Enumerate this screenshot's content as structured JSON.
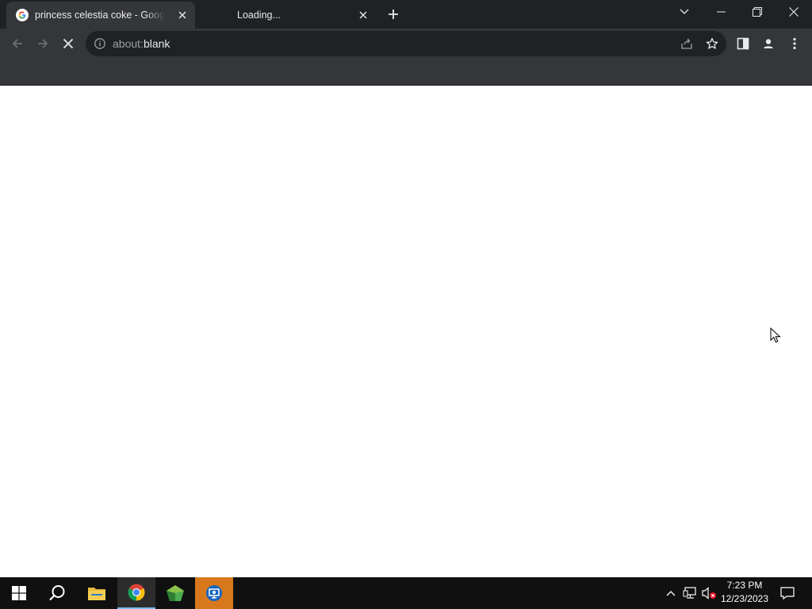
{
  "browser": {
    "tabs": [
      {
        "title": "princess celestia coke - Google S",
        "active": true,
        "favicon": "google-g-icon"
      },
      {
        "title": "Loading...",
        "active": false,
        "favicon": "loading-spinner-icon"
      }
    ],
    "omnibox": {
      "scheme": "about:",
      "host": "blank"
    },
    "colors": {
      "tabstrip": "#202124",
      "toolbar": "#35363a",
      "omnibox": "#202124"
    }
  },
  "taskbar": {
    "apps": [
      {
        "name": "start-icon"
      },
      {
        "name": "search-icon"
      },
      {
        "name": "file-explorer-icon"
      },
      {
        "name": "chrome-icon"
      },
      {
        "name": "green-gem-icon"
      },
      {
        "name": "remote-desktop-icon"
      }
    ],
    "clock": {
      "time": "7:23 PM",
      "date": "12/23/2023"
    }
  }
}
